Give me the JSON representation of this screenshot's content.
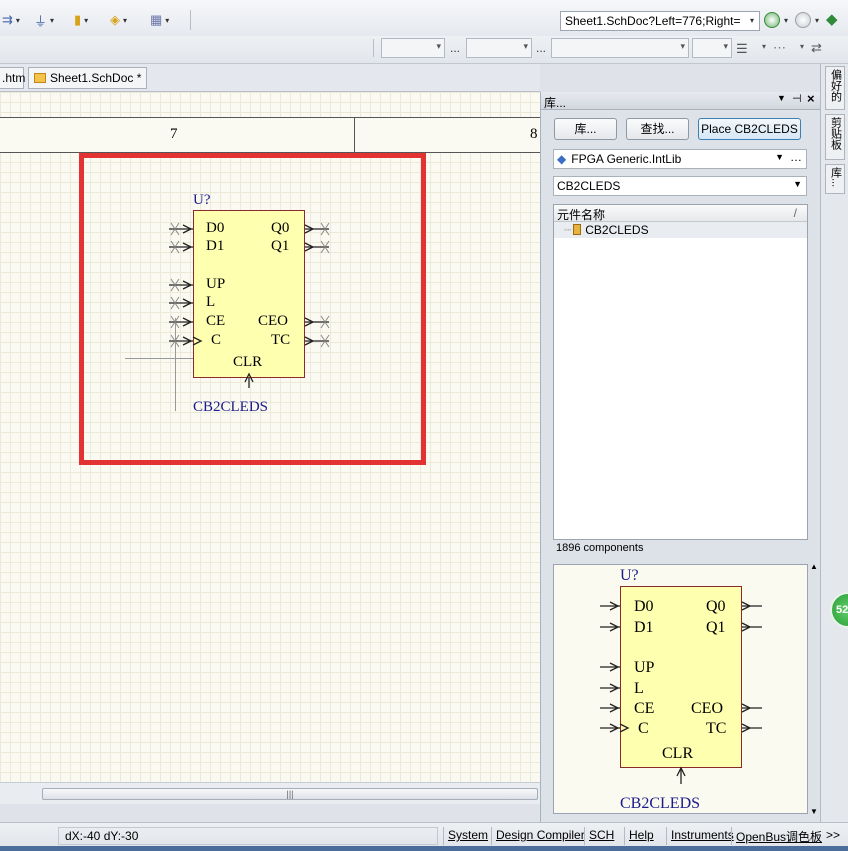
{
  "toolbar": {
    "address": "Sheet1.SchDoc?Left=776;Right=",
    "more_buttons": "...",
    "icons": [
      "bus-entry-icon",
      "ground-icon",
      "power-port-icon",
      "net-label-icon",
      "grid-icon",
      "back-icon",
      "forward-icon",
      "home-icon"
    ]
  },
  "tabs": [
    {
      "label": ".htm"
    },
    {
      "label": "Sheet1.SchDoc *"
    }
  ],
  "sheet": {
    "zones": [
      "7",
      "8"
    ],
    "symbol": {
      "designator": "U?",
      "comment": "CB2CLEDS",
      "left_pins": [
        "D0",
        "D1",
        "UP",
        "L",
        "CE",
        "C"
      ],
      "right_pins": [
        "Q0",
        "Q1",
        "CEO",
        "TC"
      ],
      "bottom_pin": "CLR"
    }
  },
  "panel": {
    "title": "库...",
    "buttons": {
      "libraries": "库...",
      "search": "查找...",
      "place": "Place CB2CLEDS"
    },
    "library": "FPGA Generic.IntLib",
    "filter": "CB2CLEDS",
    "list_header": "元件名称",
    "list_header_sort": "/",
    "items": [
      "CB2CLEDS"
    ],
    "count": "1896 components"
  },
  "right_strip": {
    "tabs": [
      "偏好的",
      "剪贴板",
      "库..."
    ],
    "badge": "52"
  },
  "status": {
    "coords": "dX:-40 dY:-30",
    "tabs": [
      "System",
      "Design Compiler",
      "SCH",
      "Help",
      "Instruments",
      "OpenBus调色板"
    ],
    "more": ">>"
  },
  "colors": {
    "highlight": "#e23232",
    "symbol_fill": "#ffffb0",
    "designator_blue": "#1a1a8c",
    "status_green": "#2a9b36"
  }
}
